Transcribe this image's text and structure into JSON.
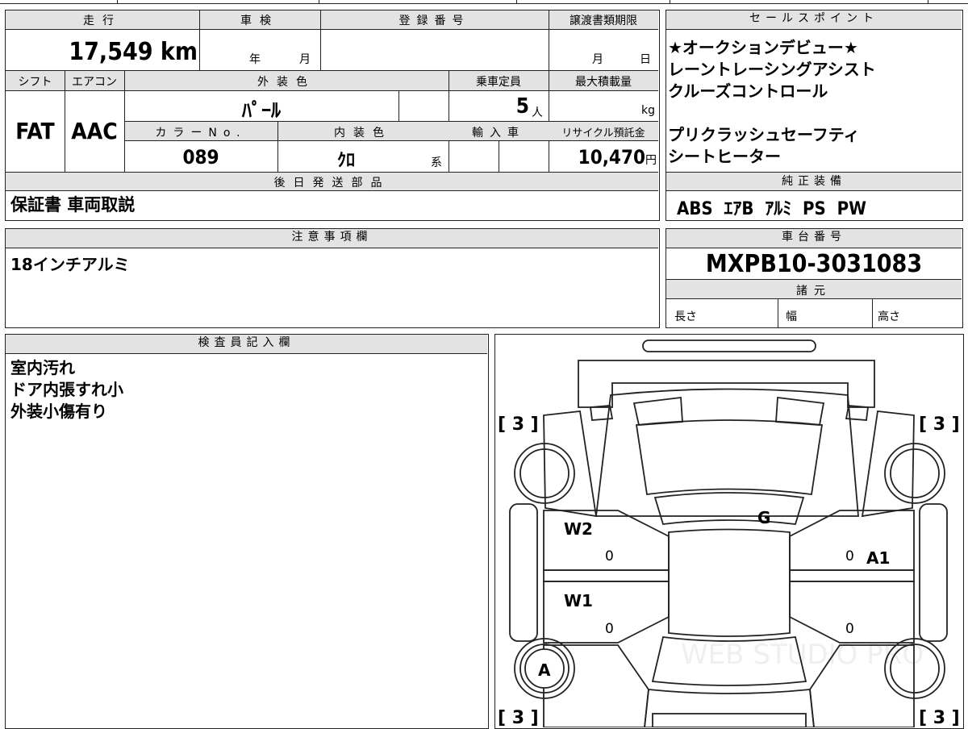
{
  "sheet": {
    "mileage": {
      "label": "走行",
      "value": "17,549",
      "unit": "km"
    },
    "shaken": {
      "label": "車検",
      "year_label": "年",
      "month_label": "月"
    },
    "registration": {
      "label": "登録番号"
    },
    "transfer_deadline": {
      "label": "譲渡書類期限",
      "month_label": "月",
      "day_label": "日"
    },
    "shift": {
      "label": "シフト",
      "value": "FAT"
    },
    "aircon": {
      "label": "エアコン",
      "value": "AAC"
    },
    "exterior_color": {
      "label": "外装色",
      "value": "ﾊﾟｰﾙ"
    },
    "capacity": {
      "label": "乗車定員",
      "value": "5",
      "unit": "人"
    },
    "max_load": {
      "label": "最大積載量",
      "unit": "kg"
    },
    "color_no": {
      "label": "カラーNo.",
      "value": "089"
    },
    "interior_color": {
      "label": "内装色",
      "value": "ｸﾛ",
      "suffix": "系"
    },
    "import": {
      "label": "輸入車"
    },
    "recycle": {
      "label": "リサイクル預託金",
      "value": "10,470",
      "unit": "円"
    }
  },
  "sales_points": {
    "title": "セールスポイント",
    "text": "★オークションデビュー★\nレーントレーシングアシスト\nクルーズコントロール\n\nプリクラッシュセーフティ\nシートヒーター"
  },
  "genuine_equipment": {
    "title": "純正装備",
    "text": "ABS  ｴｱB  ｱﾙﾐ  PS  PW"
  },
  "later_shipping": {
    "title": "後日発送部品",
    "text": "保証書 車両取説"
  },
  "notes": {
    "title": "注意事項欄",
    "text": "18インチアルミ"
  },
  "chassis": {
    "title": "車台番号",
    "value": "MXPB10-3031083"
  },
  "specs": {
    "title": "諸元",
    "length_label": "長さ",
    "width_label": "幅",
    "height_label": "高さ"
  },
  "inspector": {
    "title": "検査員記入欄",
    "text": "室内汚れ\nドア内張すれ小\n外装小傷有り"
  },
  "diagram": {
    "tire_marks": [
      "[ 3 ]",
      "[ 3 ]",
      "[ 3 ]",
      "[ 3 ]"
    ],
    "marks": {
      "w2": "W2",
      "w1": "W1",
      "g": "G",
      "a1": "A1",
      "a": "A"
    },
    "zeros": [
      "0",
      "0",
      "0",
      "0"
    ],
    "watermark": "WEB STUDIO PRO"
  }
}
